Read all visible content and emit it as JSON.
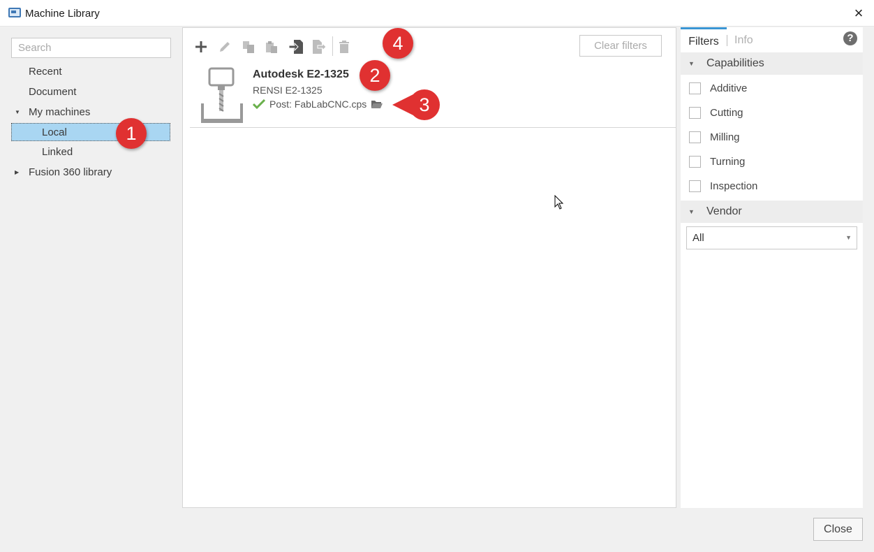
{
  "window": {
    "title": "Machine Library",
    "close_glyph": "×"
  },
  "left": {
    "search_placeholder": "Search",
    "tree": [
      {
        "label": "Recent"
      },
      {
        "label": "Document"
      },
      {
        "label": "My machines",
        "expanded": true
      },
      {
        "label": "Local",
        "selected": true
      },
      {
        "label": "Linked"
      },
      {
        "label": "Fusion 360 library",
        "expanded": false
      }
    ]
  },
  "toolbar": {
    "icons": [
      "add-icon",
      "edit-icon",
      "copy-icon",
      "paste-icon",
      "import-icon",
      "export-icon",
      "delete-icon"
    ],
    "clear_filters": "Clear filters"
  },
  "machines": [
    {
      "name": "Autodesk E2-1325",
      "model": "RENSI E2-1325",
      "post": "Post: FabLabCNC.cps"
    }
  ],
  "filters": {
    "tab_filters": "Filters",
    "tab_info": "Info",
    "help_glyph": "?",
    "capabilities_label": "Capabilities",
    "capabilities": [
      "Additive",
      "Cutting",
      "Milling",
      "Turning",
      "Inspection"
    ],
    "vendor_label": "Vendor",
    "vendor_value": "All"
  },
  "footer": {
    "close": "Close"
  },
  "callouts": [
    "1",
    "2",
    "3",
    "4"
  ],
  "colors": {
    "accent": "#3a95d4",
    "selection": "#a9d6f2",
    "callout": "#e03131",
    "check": "#6ab04c"
  }
}
